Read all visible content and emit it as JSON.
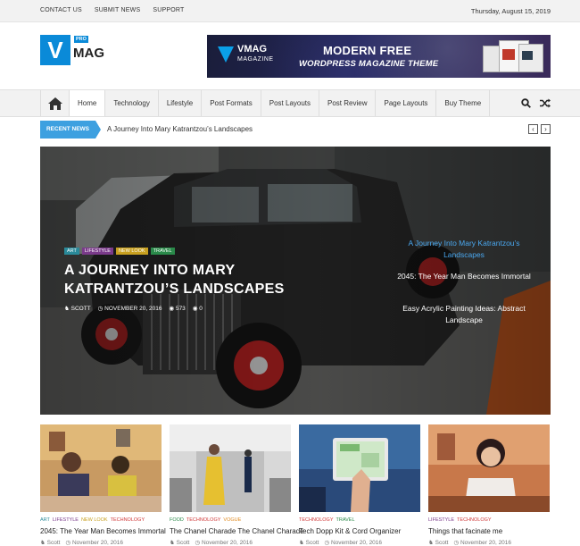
{
  "topbar": {
    "links": [
      "CONTACT US",
      "SUBMIT NEWS",
      "SUPPORT"
    ],
    "date": "Thursday, August 15, 2019"
  },
  "logo": {
    "letter": "V",
    "name": "MAG",
    "badge": "PRO"
  },
  "banner": {
    "brand": "VMAG",
    "brand_sub": "MAGAZINE",
    "headline": "MODERN FREE",
    "subline": "WORDPRESS MAGAZINE THEME"
  },
  "nav": {
    "items": [
      "Home",
      "Technology",
      "Lifestyle",
      "Post Formats",
      "Post Layouts",
      "Post Review",
      "Page Layouts",
      "Buy Theme"
    ],
    "active_index": 0
  },
  "ticker": {
    "label": "RECENT NEWS",
    "text": "A Journey Into Mary Katrantzou’s Landscapes",
    "prev": "‹",
    "next": "›"
  },
  "hero": {
    "categories": [
      {
        "label": "ART",
        "color": "#2a8a9a"
      },
      {
        "label": "LIFESTYLE",
        "color": "#7a3a8a"
      },
      {
        "label": "NEW LOOK",
        "color": "#c8a020"
      },
      {
        "label": "TRAVEL",
        "color": "#2a8a4a"
      }
    ],
    "title": "A JOURNEY INTO MARY KATRANTZOU’S LANDSCAPES",
    "author": "SCOTT",
    "date": "NOVEMBER 20, 2016",
    "views": "573",
    "comments": "0",
    "side_posts": [
      "A Journey Into Mary Katrantzou’s Landscapes",
      "2045: The Year Man Becomes Immortal",
      "Easy Acrylic Painting Ideas: Abstract Landscape"
    ]
  },
  "cards": [
    {
      "tags": [
        {
          "label": "ART",
          "color": "#2a8a9a"
        },
        {
          "label": "LIFESTYLE",
          "color": "#7a3a8a"
        },
        {
          "label": "NEW LOOK",
          "color": "#c8a020"
        },
        {
          "label": "TECHNOLOGY",
          "color": "#d03a3a"
        }
      ],
      "title": "2045: The Year Man Becomes Immortal",
      "author": "Scott",
      "date": "November 20, 2016"
    },
    {
      "tags": [
        {
          "label": "FOOD",
          "color": "#2a8a4a"
        },
        {
          "label": "TECHNOLOGY",
          "color": "#d03a3a"
        },
        {
          "label": "VOGUE",
          "color": "#e08a20"
        }
      ],
      "title": "The Chanel Charade The Chanel Charade",
      "author": "Scott",
      "date": "November 20, 2016"
    },
    {
      "tags": [
        {
          "label": "TECHNOLOGY",
          "color": "#d03a3a"
        },
        {
          "label": "TRAVEL",
          "color": "#2a8a4a"
        }
      ],
      "title": "Tech Dopp Kit & Cord Organizer",
      "author": "Scott",
      "date": "November 20, 2016"
    },
    {
      "tags": [
        {
          "label": "LIFESTYLE",
          "color": "#7a3a8a"
        },
        {
          "label": "TECHNOLOGY",
          "color": "#d03a3a"
        }
      ],
      "title": "Things that facinate me",
      "author": "Scott",
      "date": "November 20, 2016"
    }
  ],
  "colors": {
    "accent": "#0a8ad8",
    "ticker": "#3da0e0",
    "hero_active": "#4aa8f0"
  }
}
